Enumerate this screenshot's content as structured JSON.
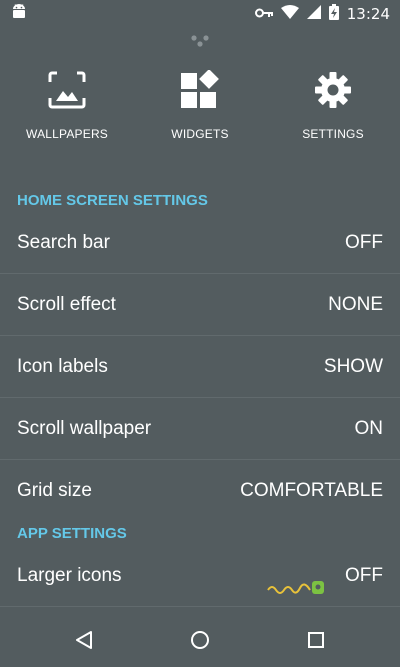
{
  "status_bar": {
    "time": "13:24",
    "icons": [
      "android-icon",
      "vpn-key-icon",
      "wifi-icon",
      "signal-icon",
      "battery-charging-icon"
    ]
  },
  "shortcuts": [
    {
      "label": "WALLPAPERS",
      "icon": "wallpaper-icon"
    },
    {
      "label": "WIDGETS",
      "icon": "widgets-icon"
    },
    {
      "label": "SETTINGS",
      "icon": "gear-icon"
    }
  ],
  "home_screen": {
    "header": "HOME SCREEN SETTINGS",
    "items": [
      {
        "label": "Search bar",
        "value": "OFF"
      },
      {
        "label": "Scroll effect",
        "value": "NONE"
      },
      {
        "label": "Icon labels",
        "value": "SHOW"
      },
      {
        "label": "Scroll wallpaper",
        "value": "ON"
      },
      {
        "label": "Grid size",
        "value": "COMFORTABLE"
      }
    ]
  },
  "app_settings": {
    "header": "APP SETTINGS",
    "items": [
      {
        "label": "Larger icons",
        "value": "OFF"
      }
    ]
  },
  "nav": {
    "icons": [
      "back-icon",
      "home-icon",
      "recents-icon"
    ]
  },
  "colors": {
    "background": "#535c5f",
    "accent": "#64c8e8",
    "text": "#ffffff"
  }
}
